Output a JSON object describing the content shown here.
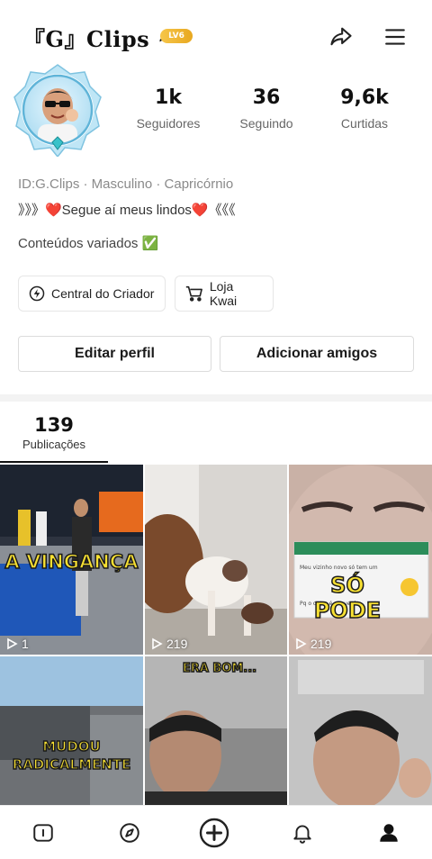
{
  "header": {
    "title": "『G』Clips ~",
    "level_badge": "LV6"
  },
  "profile": {
    "stats": [
      {
        "value": "1k",
        "label": "Seguidores"
      },
      {
        "value": "36",
        "label": "Seguindo"
      },
      {
        "value": "9,6k",
        "label": "Curtidas"
      }
    ],
    "meta": "ID:G.Clips · Masculino · Capricórnio",
    "motto": "》》》❤️Segue aí meus lindos❤️《《《",
    "bio": "Conteúdos variados ✅"
  },
  "shortcuts": {
    "creator_center": "Central do Criador",
    "shop": "Loja Kwai"
  },
  "actions": {
    "edit_profile": "Editar perfil",
    "add_friends": "Adicionar amigos"
  },
  "tabs": {
    "posts_count": "139",
    "posts_label": "Publicações"
  },
  "videos": [
    {
      "caption": "A VINGANÇA",
      "views": "1"
    },
    {
      "caption": "",
      "views": "219"
    },
    {
      "caption": "SÓ PODE",
      "views": "219"
    },
    {
      "caption": "MUDOU RADICALMENTE",
      "views": ""
    },
    {
      "caption": "ERA BOM...",
      "views": ""
    },
    {
      "caption": "",
      "views": ""
    }
  ],
  "colors": {
    "accent": "#111111",
    "badge": "#f0b52d",
    "heart": "#e53935"
  },
  "icons": {
    "share": "share-icon",
    "menu": "menu-icon",
    "home": "home-icon",
    "discover": "compass-icon",
    "create": "plus-circle-icon",
    "notifications": "bell-icon",
    "profile": "user-icon"
  }
}
